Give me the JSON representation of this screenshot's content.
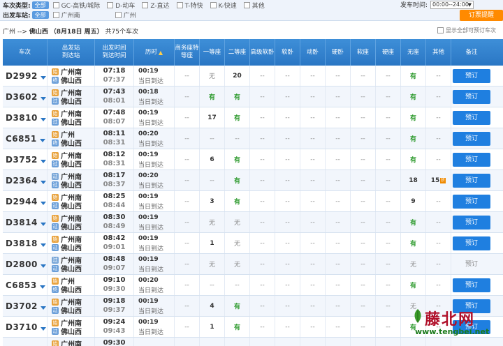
{
  "filters": {
    "type_label": "车次类型:",
    "type_all": "全部",
    "types": [
      "GC-高铁/城际",
      "D-动车",
      "Z-直达",
      "T-特快",
      "K-快速",
      "其他"
    ],
    "from_label": "出发车站:",
    "from_all": "全部",
    "from_stations": [
      "广州南",
      "广州"
    ],
    "time_label": "发车时间:",
    "time_value": "00:00--24:00",
    "submit": "订票提醒"
  },
  "route": {
    "from": "广州",
    "arrow": "-->",
    "to": "佛山西",
    "date": "（8月18日 周五）",
    "count": "共75个车次"
  },
  "show_all": "显示全部可预订车次",
  "headers": {
    "train": "车次",
    "station_a": "出发站",
    "station_b": "到达站",
    "time_a": "出发时间",
    "time_b": "到达时间",
    "duration": "历时",
    "business": "商务座特等座",
    "first": "一等座",
    "second": "二等座",
    "adv_soft": "高级软卧",
    "soft_sleeper": "软卧",
    "moving_sleeper": "动卧",
    "hard_sleeper": "硬卧",
    "soft_seat": "软座",
    "hard_seat": "硬座",
    "no_seat": "无座",
    "other": "其他",
    "note": "备注"
  },
  "rows": [
    {
      "train": "D2992",
      "from": "广州南",
      "to": "佛山西",
      "from_icon": "始",
      "to_icon": "终",
      "dep": "07:18",
      "arr": "07:37",
      "dur": "00:19",
      "day": "当日到达",
      "seats": [
        "--",
        "无",
        "20",
        "--",
        "--",
        "--",
        "--",
        "--",
        "--",
        "有",
        "--"
      ],
      "book": "预订"
    },
    {
      "train": "D3602",
      "from": "广州南",
      "to": "佛山西",
      "from_icon": "始",
      "to_icon": "过",
      "dep": "07:43",
      "arr": "08:01",
      "dur": "00:18",
      "day": "当日到达",
      "seats": [
        "--",
        "有",
        "有",
        "--",
        "--",
        "--",
        "--",
        "--",
        "--",
        "有",
        "--"
      ],
      "book": "预订"
    },
    {
      "train": "D3810",
      "from": "广州南",
      "to": "佛山西",
      "from_icon": "始",
      "to_icon": "过",
      "dep": "07:48",
      "arr": "08:07",
      "dur": "00:19",
      "day": "当日到达",
      "seats": [
        "--",
        "17",
        "有",
        "--",
        "--",
        "--",
        "--",
        "--",
        "--",
        "有",
        "--"
      ],
      "book": "预订"
    },
    {
      "train": "C6851",
      "from": "广州",
      "to": "佛山西",
      "from_icon": "始",
      "to_icon": "终",
      "dep": "08:11",
      "arr": "08:31",
      "dur": "00:20",
      "day": "当日到达",
      "seats": [
        "--",
        "--",
        "--",
        "--",
        "--",
        "--",
        "--",
        "--",
        "--",
        "有",
        "--"
      ],
      "book": "预订"
    },
    {
      "train": "D3752",
      "from": "广州南",
      "to": "佛山西",
      "from_icon": "始",
      "to_icon": "过",
      "dep": "08:12",
      "arr": "08:31",
      "dur": "00:19",
      "day": "当日到达",
      "seats": [
        "--",
        "6",
        "有",
        "--",
        "--",
        "--",
        "--",
        "--",
        "--",
        "有",
        "--"
      ],
      "book": "预订"
    },
    {
      "train": "D2364",
      "from": "广州南",
      "to": "佛山西",
      "from_icon": "过",
      "to_icon": "过",
      "dep": "08:17",
      "arr": "08:37",
      "dur": "00:20",
      "day": "当日到达",
      "seats": [
        "--",
        "--",
        "有",
        "--",
        "--",
        "--",
        "--",
        "--",
        "--",
        "18",
        "15"
      ],
      "book": "预订"
    },
    {
      "train": "D2944",
      "from": "广州南",
      "to": "佛山西",
      "from_icon": "始",
      "to_icon": "过",
      "dep": "08:25",
      "arr": "08:44",
      "dur": "00:19",
      "day": "当日到达",
      "seats": [
        "--",
        "3",
        "有",
        "--",
        "--",
        "--",
        "--",
        "--",
        "--",
        "9",
        "--"
      ],
      "book": "预订"
    },
    {
      "train": "D3814",
      "from": "广州南",
      "to": "佛山西",
      "from_icon": "始",
      "to_icon": "过",
      "dep": "08:30",
      "arr": "08:49",
      "dur": "00:19",
      "day": "当日到达",
      "seats": [
        "--",
        "无",
        "无",
        "--",
        "--",
        "--",
        "--",
        "--",
        "--",
        "有",
        "--"
      ],
      "book": "预订"
    },
    {
      "train": "D3818",
      "from": "广州南",
      "to": "佛山西",
      "from_icon": "始",
      "to_icon": "过",
      "dep": "08:42",
      "arr": "09:01",
      "dur": "00:19",
      "day": "当日到达",
      "seats": [
        "--",
        "1",
        "无",
        "--",
        "--",
        "--",
        "--",
        "--",
        "--",
        "有",
        "--"
      ],
      "book": "预订"
    },
    {
      "train": "D2800",
      "from": "广州南",
      "to": "佛山西",
      "from_icon": "过",
      "to_icon": "过",
      "dep": "08:48",
      "arr": "09:07",
      "dur": "00:19",
      "day": "当日到达",
      "seats": [
        "--",
        "无",
        "无",
        "--",
        "--",
        "--",
        "--",
        "--",
        "--",
        "无",
        "--"
      ],
      "book": "预订",
      "book_off": true
    },
    {
      "train": "C6853",
      "from": "广州",
      "to": "佛山西",
      "from_icon": "始",
      "to_icon": "终",
      "dep": "09:10",
      "arr": "09:30",
      "dur": "00:20",
      "day": "当日到达",
      "seats": [
        "--",
        "--",
        "--",
        "--",
        "--",
        "--",
        "--",
        "--",
        "--",
        "有",
        "--"
      ],
      "book": "预订"
    },
    {
      "train": "D3702",
      "from": "广州南",
      "to": "佛山西",
      "from_icon": "始",
      "to_icon": "过",
      "dep": "09:18",
      "arr": "09:37",
      "dur": "00:19",
      "day": "当日到达",
      "seats": [
        "--",
        "4",
        "有",
        "--",
        "--",
        "--",
        "--",
        "--",
        "--",
        "无",
        "--"
      ],
      "book": "预订"
    },
    {
      "train": "D3710",
      "from": "广州南",
      "to": "佛山西",
      "from_icon": "始",
      "to_icon": "过",
      "dep": "09:24",
      "arr": "09:43",
      "dur": "00:19",
      "day": "当日到达",
      "seats": [
        "--",
        "1",
        "有",
        "--",
        "--",
        "--",
        "--",
        "--",
        "--",
        "有",
        "--"
      ],
      "book": "预订"
    },
    {
      "train": "",
      "from": "广州南",
      "to": "",
      "from_icon": "始",
      "to_icon": "",
      "dep": "09:30",
      "arr": "",
      "dur": "",
      "day": "",
      "seats": [
        "",
        "",
        "",
        "",
        "",
        "",
        "",
        "",
        "",
        "",
        ""
      ],
      "book": ""
    }
  ],
  "watermark": {
    "title": "藤北网",
    "url": "www.tengbei.net"
  },
  "colors": {
    "header_blue": "#2a76c4",
    "button_blue": "#1f7fe0",
    "available_green": "#2d9a2d",
    "filter_orange": "#ff8a00"
  }
}
